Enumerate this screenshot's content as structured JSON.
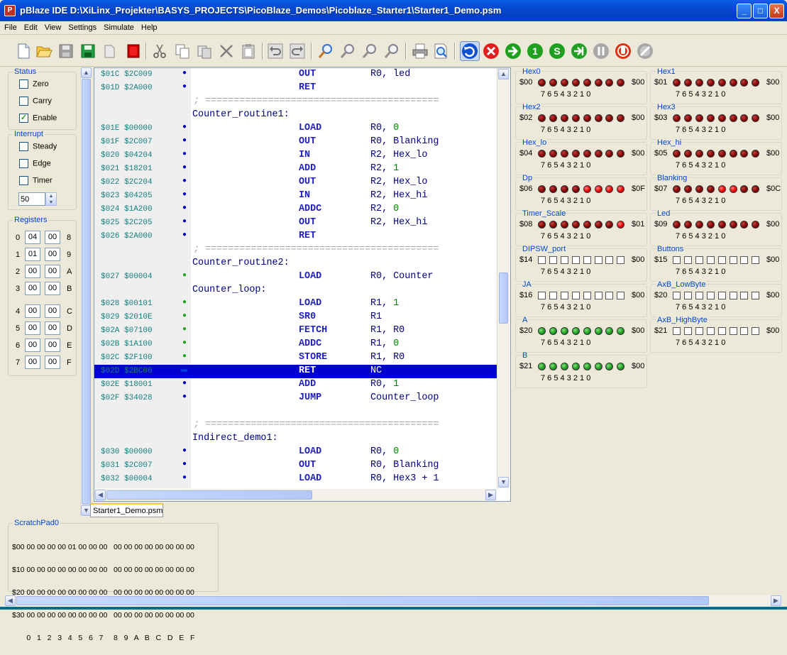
{
  "window": {
    "title": "pBlaze IDE  D:\\XiLinx_Projekter\\BASYS_PROJECTS\\PicoBlaze_Demos\\Picoblaze_Starter1\\Starter1_Demo.psm",
    "icon_letter": "P",
    "min": "_",
    "max": "□",
    "close": "X"
  },
  "menu": [
    "File",
    "Edit",
    "View",
    "Settings",
    "Simulate",
    "Help"
  ],
  "toolbar": {
    "file": [
      "new-icon",
      "open-icon",
      "save-icon",
      "save-all-icon",
      "close-file-icon",
      "exit-icon"
    ],
    "edit": [
      "cut-icon",
      "copy-icon",
      "copy-special-icon",
      "delete-icon",
      "paste-icon"
    ],
    "history": [
      "undo-icon",
      "redo-icon"
    ],
    "find": [
      "find-icon",
      "find-next-icon",
      "find-prev-icon",
      "replace-icon"
    ],
    "print": [
      "print-icon",
      "print-preview-icon"
    ],
    "sim": [
      "reset-icon",
      "stop-icon",
      "run-icon",
      "step-icon",
      "step-over-icon",
      "step-out-icon",
      "pause-icon",
      "breakpoint-icon",
      "clear-breakpoints-icon"
    ]
  },
  "status_group": {
    "title": "Status",
    "items": [
      {
        "label": "Zero",
        "checked": false
      },
      {
        "label": "Carry",
        "checked": false
      },
      {
        "label": "Enable",
        "checked": true
      }
    ]
  },
  "interrupt_group": {
    "title": "Interrupt",
    "items": [
      {
        "label": "Steady",
        "checked": false
      },
      {
        "label": "Edge",
        "checked": false
      },
      {
        "label": "Timer",
        "checked": false
      }
    ],
    "timer_value": "50"
  },
  "registers": {
    "title": "Registers",
    "rows": [
      {
        "idx": "0",
        "a": "04",
        "b": "00",
        "hi": "8"
      },
      {
        "idx": "1",
        "a": "01",
        "b": "00",
        "hi": "9"
      },
      {
        "idx": "2",
        "a": "00",
        "b": "00",
        "hi": "A"
      },
      {
        "idx": "3",
        "a": "00",
        "b": "00",
        "hi": "B"
      },
      {
        "idx": "4",
        "a": "00",
        "b": "00",
        "hi": "C"
      },
      {
        "idx": "5",
        "a": "00",
        "b": "00",
        "hi": "D"
      },
      {
        "idx": "6",
        "a": "00",
        "b": "00",
        "hi": "E"
      },
      {
        "idx": "7",
        "a": "00",
        "b": "00",
        "hi": "F"
      }
    ]
  },
  "code_lines": [
    {
      "addr": "$01C $2C009",
      "dot": "blue",
      "op": "OUT",
      "args": "R0, led"
    },
    {
      "addr": "$01D $2A000",
      "dot": "blue",
      "op": "RET",
      "args": ""
    },
    {
      "comment": "; ========================================="
    },
    {
      "label": "Counter_routine1:"
    },
    {
      "addr": "$01E $00000",
      "dot": "blue",
      "op": "LOAD",
      "args": "R0, ",
      "num": "0"
    },
    {
      "addr": "$01F $2C007",
      "dot": "blue",
      "op": "OUT",
      "args": "R0, Blanking"
    },
    {
      "addr": "$020 $04204",
      "dot": "blue",
      "op": "IN",
      "args": "R2, Hex_lo"
    },
    {
      "addr": "$021 $18201",
      "dot": "blue",
      "op": "ADD",
      "args": "R2, ",
      "num": "1"
    },
    {
      "addr": "$022 $2C204",
      "dot": "blue",
      "op": "OUT",
      "args": "R2, Hex_lo"
    },
    {
      "addr": "$023 $04205",
      "dot": "blue",
      "op": "IN",
      "args": "R2, Hex_hi"
    },
    {
      "addr": "$024 $1A200",
      "dot": "blue",
      "op": "ADDC",
      "args": "R2, ",
      "num": "0"
    },
    {
      "addr": "$025 $2C205",
      "dot": "blue",
      "op": "OUT",
      "args": "R2, Hex_hi"
    },
    {
      "addr": "$026 $2A000",
      "dot": "blue",
      "op": "RET",
      "args": ""
    },
    {
      "comment": "; ========================================="
    },
    {
      "label": "Counter_routine2:"
    },
    {
      "addr": "$027 $00004",
      "dot": "green",
      "op": "LOAD",
      "args": "R0, Counter"
    },
    {
      "label": "Counter_loop:"
    },
    {
      "addr": "$028 $00101",
      "dot": "green",
      "op": "LOAD",
      "args": "R1, ",
      "num": "1"
    },
    {
      "addr": "$029 $2010E",
      "dot": "green",
      "op": "SR0",
      "args": "R1"
    },
    {
      "addr": "$02A $07100",
      "dot": "green",
      "op": "FETCH",
      "args": "R1, R0"
    },
    {
      "addr": "$02B $1A100",
      "dot": "green",
      "op": "ADDC",
      "args": "R1, ",
      "num": "0"
    },
    {
      "addr": "$02C $2F100",
      "dot": "green",
      "op": "STORE",
      "args": "R1, R0"
    },
    {
      "addr": "$02D $2BC00",
      "dot": "arrow",
      "op": "RET",
      "args": "NC",
      "current": true
    },
    {
      "addr": "$02E $18001",
      "dot": "blue",
      "op": "ADD",
      "args": "R0, ",
      "num": "1"
    },
    {
      "addr": "$02F $34028",
      "dot": "blue",
      "op": "JUMP",
      "args": "Counter_loop"
    },
    {
      "blank": true
    },
    {
      "comment": "; ========================================="
    },
    {
      "label": "Indirect_demo1:"
    },
    {
      "addr": "$030 $00000",
      "dot": "blue",
      "op": "LOAD",
      "args": "R0, ",
      "num": "0"
    },
    {
      "addr": "$031 $2C007",
      "dot": "blue",
      "op": "OUT",
      "args": "R0, Blanking"
    },
    {
      "addr": "$032 $00004",
      "dot": "blue",
      "op": "LOAD",
      "args": "R0, Hex3 + 1"
    }
  ],
  "editor_tab": "Starter1_Demo.psm",
  "bit_labels": "7 6 5 4 3 2 1 0",
  "io_ports": [
    {
      "name": "Hex0",
      "port": "$00",
      "value": "$00",
      "leds": "rrrrrrrr"
    },
    {
      "name": "Hex1",
      "port": "$01",
      "value": "$00",
      "leds": "rrrrrrrr"
    },
    {
      "name": "Hex2",
      "port": "$02",
      "value": "$00",
      "leds": "rrrrrrrr"
    },
    {
      "name": "Hex3",
      "port": "$03",
      "value": "$00",
      "leds": "rrrrrrrr"
    },
    {
      "name": "Hex_lo",
      "port": "$04",
      "value": "$00",
      "leds": "rrrrrrrr"
    },
    {
      "name": "Hex_hi",
      "port": "$05",
      "value": "$00",
      "leds": "rrrrrrrr"
    },
    {
      "name": "Dp",
      "port": "$06",
      "value": "$0F",
      "leds": "rrrrRRRR"
    },
    {
      "name": "Blanking",
      "port": "$07",
      "value": "$0C",
      "leds": "rrrrRRrr"
    },
    {
      "name": "Timer_Scale",
      "port": "$08",
      "value": "$01",
      "leds": "rrrrrrrR"
    },
    {
      "name": "Led",
      "port": "$09",
      "value": "$00",
      "leds": "rrrrrrrr"
    },
    {
      "name": "DIPSW_port",
      "port": "$14",
      "value": "$00",
      "leds": "bbbbbbbb"
    },
    {
      "name": "Buttons",
      "port": "$15",
      "value": "$00",
      "leds": "bbbbbbbb"
    },
    {
      "name": "JA",
      "port": "$16",
      "value": "$00",
      "leds": "bbbbbbbb"
    },
    {
      "name": "AxB_LowByte",
      "port": "$20",
      "value": "$00",
      "leds": "bbbbbbbb"
    },
    {
      "name": "A",
      "port": "$20",
      "value": "$00",
      "leds": "gggggggg"
    },
    {
      "name": "AxB_HighByte",
      "port": "$21",
      "value": "$00",
      "leds": "bbbbbbbb"
    },
    {
      "name": "B",
      "port": "$21",
      "value": "$00",
      "leds": "gggggggg"
    }
  ],
  "scratchpad": {
    "title": "ScratchPad0",
    "rows": [
      "$00 00 00 00 00 01 00 00 00   00 00 00 00 00 00 00 00",
      "$10 00 00 00 00 00 00 00 00   00 00 00 00 00 00 00 00",
      "$20 00 00 00 00 00 00 00 00   00 00 00 00 00 00 00 00",
      "$30 00 00 00 00 00 00 00 00   00 00 00 00 00 00 00 00"
    ],
    "footer": "       0   1   2   3   4   5   6   7     8   9   A   B   C   D   E   F"
  },
  "colors": {
    "accent": "#0046D5",
    "selection": "#0000D0",
    "led_red": "#F00000",
    "led_green": "#20A020"
  }
}
